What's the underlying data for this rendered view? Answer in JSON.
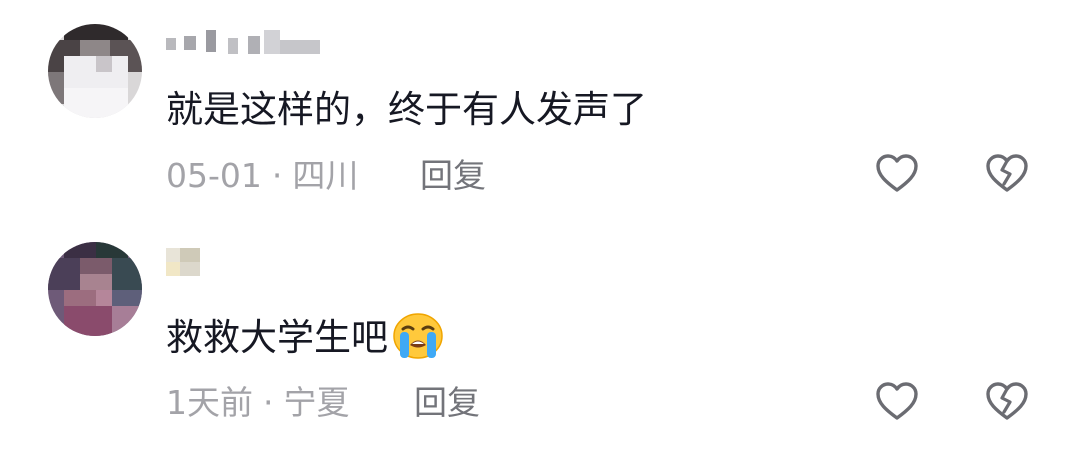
{
  "comments": [
    {
      "text": "就是这样的，终于有人发声了",
      "date": "05-01",
      "separator": "·",
      "location": "四川",
      "reply_label": "回复"
    },
    {
      "text": "救救大学生吧",
      "emoji": "loudly-crying-face",
      "date": "1天前",
      "separator": "·",
      "location": "宁夏",
      "reply_label": "回复"
    }
  ],
  "icons": {
    "like": "heart-outline-icon",
    "dislike": "broken-heart-icon"
  },
  "colors": {
    "primary_text": "#161823",
    "meta_text": "#a3a3a8",
    "reply_text": "#73747a",
    "icon_stroke": "#6b6c72"
  }
}
